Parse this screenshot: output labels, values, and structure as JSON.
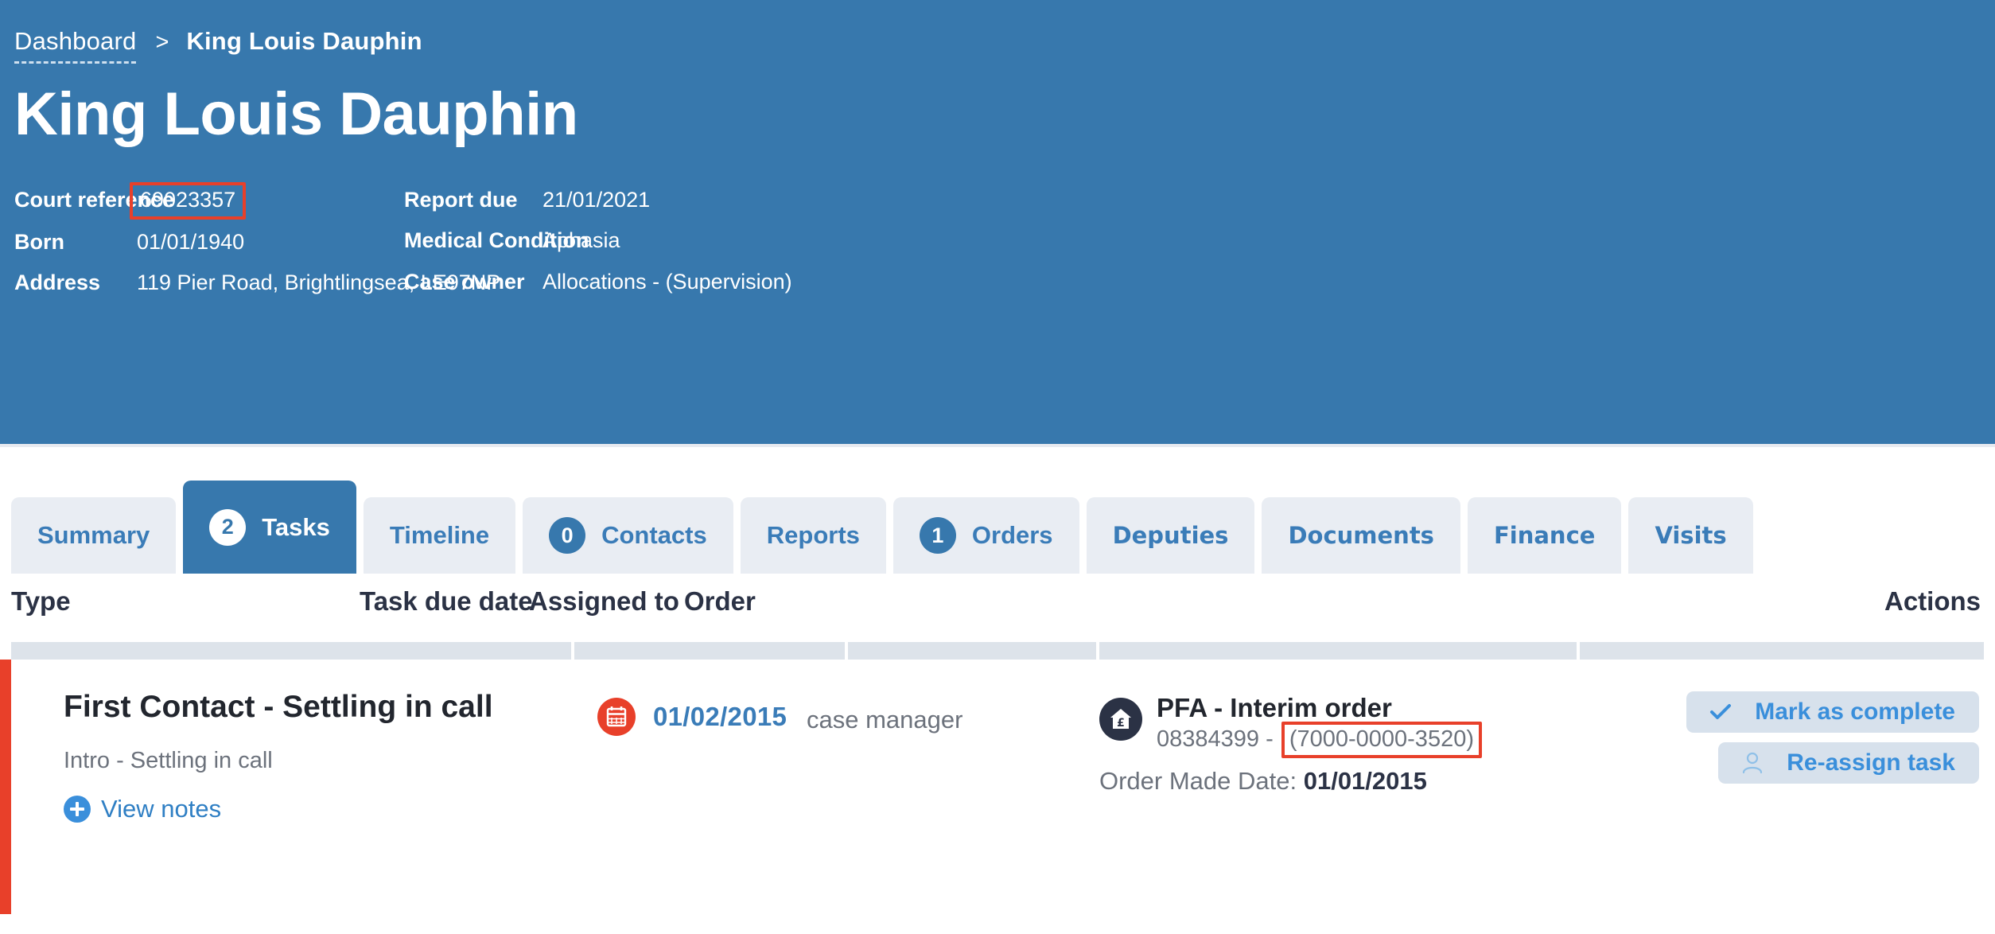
{
  "breadcrumb": {
    "root": "Dashboard",
    "separator": ">",
    "current": "King Louis Dauphin"
  },
  "header": {
    "title": "King Louis Dauphin",
    "details_left": [
      {
        "label": "Court reference",
        "value": "69023357",
        "highlighted": true
      },
      {
        "label": "Born",
        "value": "01/01/1940",
        "highlighted": false
      },
      {
        "label": "Address",
        "value": "119 Pier Road, Brightlingsea, LE97NP",
        "highlighted": false
      }
    ],
    "details_right": [
      {
        "label": "Report due",
        "value": "21/01/2021"
      },
      {
        "label": "Medical Condition",
        "value": "Aphasia"
      },
      {
        "label": "Case owner",
        "value": "Allocations - (Supervision)"
      }
    ]
  },
  "tabs": [
    {
      "label": "Summary",
      "badge": null,
      "active": false
    },
    {
      "label": "Tasks",
      "badge": "2",
      "active": true
    },
    {
      "label": "Timeline",
      "badge": null,
      "active": false
    },
    {
      "label": "Contacts",
      "badge": "0",
      "active": false
    },
    {
      "label": "Reports",
      "badge": null,
      "active": false
    },
    {
      "label": "Orders",
      "badge": "1",
      "active": false
    },
    {
      "label": "Deputies",
      "badge": null,
      "active": false
    },
    {
      "label": "Documents",
      "badge": null,
      "active": false
    },
    {
      "label": "Finance",
      "badge": null,
      "active": false
    },
    {
      "label": "Visits",
      "badge": null,
      "active": false
    }
  ],
  "table": {
    "columns": [
      "Type",
      "Task due date",
      "Assigned to",
      "Order",
      "Actions"
    ],
    "rows": [
      {
        "type_title": "First Contact - Settling in call",
        "type_subtitle": "Intro - Settling in call",
        "view_notes_label": "View notes",
        "due_date": "01/02/2015",
        "assigned_to": "case manager",
        "order_name": "PFA - Interim order",
        "order_ref_prefix": "08384399 - ",
        "order_ref_highlight": "(7000-0000-3520)",
        "order_made_label": "Order Made Date: ",
        "order_made_date": "01/01/2015",
        "actions": [
          {
            "label": "Mark as complete",
            "icon": "check-icon"
          },
          {
            "label": "Re-assign task",
            "icon": "user-icon"
          }
        ]
      }
    ]
  },
  "colors": {
    "brand_blue": "#3778ad",
    "accent_red": "#e8402a",
    "link_blue": "#3a8fdb",
    "tab_inactive_bg": "#e9edf3",
    "strip_gray": "#dde3ea"
  }
}
